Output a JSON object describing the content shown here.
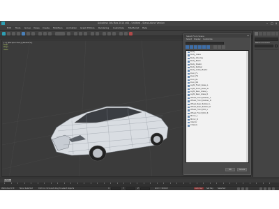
{
  "window": {
    "title": "Autodesk 3ds Max 2014 x64 - Untitled - Stand-alone Version",
    "logo_icon": "3dsmax-logo-icon",
    "accent": "#2e9fb3"
  },
  "menu": [
    "Edit",
    "Tools",
    "Group",
    "Views",
    "Create",
    "Modifiers",
    "Animation",
    "Graph Editors",
    "Rendering",
    "Customize",
    "MAXScript",
    "Help"
  ],
  "viewport": {
    "label": "[+] [Perspective] [Realistic]",
    "stats": [
      "Total",
      "Polys",
      "Verts"
    ],
    "model": "car-wireframe"
  },
  "dialog": {
    "title": "Select From Scene",
    "close": "×",
    "tabs": [
      "Select",
      "Display",
      "Customize"
    ],
    "items": [
      "Body",
      "Body_Glass",
      "Body_Chrome",
      "Body_Black",
      "Body_Plastic",
      "Body_Rubber",
      "Body_Grille_Plastic",
      "Door_FL",
      "Door_FR",
      "Door_RL",
      "Door_RR",
      "Light_Front_Glass_L",
      "Light_Front_Glass_R",
      "Light_Rear_Glass_L",
      "Light_Rear_Glass_R",
      "Wheel_Front_Rubber_L",
      "Wheel_Front_Rubber_R",
      "Wheel_Rear_Rubber_L",
      "Wheel_Rear_Rubber_R",
      "Wheel_Front_Rim_L",
      "Wheel_Front_Rim_R",
      "Mirror_L",
      "Mirror_R",
      "Interior",
      "Chassis"
    ],
    "ok_label": "OK",
    "cancel_label": "Cancel"
  },
  "command_panel": {
    "name_label": "Name and Color",
    "swatch_color": "#b0c4ff"
  },
  "timeline": {
    "slider": "0 / 100"
  },
  "status": {
    "selection": "None Selected",
    "prompt": "Click or click-and-drag to select objects",
    "welcome": "Welcome to M",
    "x_label": "X:",
    "y_label": "Y:",
    "z_label": "Z:",
    "grid": "Grid = 10,0cm",
    "autokey": "Auto Key",
    "setkey": "Set Key",
    "selected": "Selected"
  }
}
